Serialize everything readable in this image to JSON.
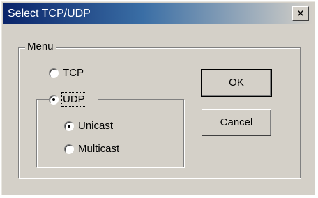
{
  "window": {
    "title": "Select TCP/UDP",
    "close_glyph": "✕"
  },
  "menu": {
    "label": "Menu",
    "tcp_label": "TCP",
    "udp_label": "UDP",
    "selected_protocol": "UDP",
    "udp_options": {
      "unicast_label": "Unicast",
      "multicast_label": "Multicast",
      "selected": "Unicast"
    }
  },
  "buttons": {
    "ok_label": "OK",
    "cancel_label": "Cancel"
  }
}
